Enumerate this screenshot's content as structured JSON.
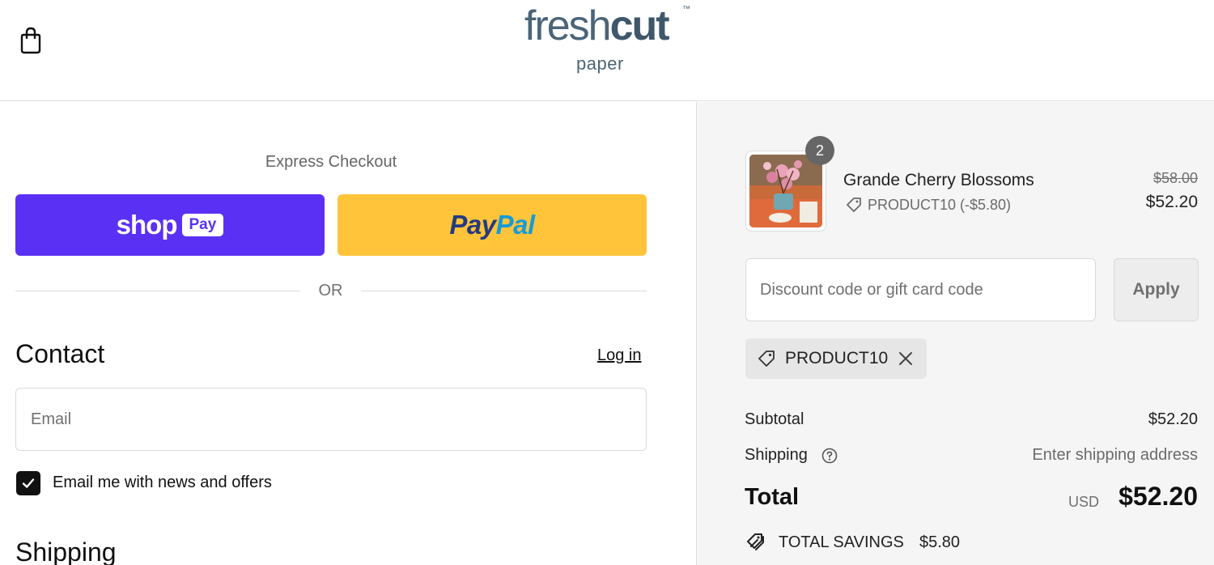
{
  "header": {
    "logo_main_light": "fresh",
    "logo_main_bold": "cut",
    "logo_tm": "™",
    "logo_sub": "paper",
    "cart_icon": "shopping-bag-icon"
  },
  "express": {
    "label": "Express Checkout",
    "shop_pay_word": "shop",
    "shop_pay_badge": "Pay",
    "paypal_pay": "Pay",
    "paypal_pal": "Pal",
    "or_label": "OR"
  },
  "contact": {
    "heading": "Contact",
    "login_link": "Log in",
    "email_placeholder": "Email",
    "email_value": "",
    "newsletter_label": "Email me with news and offers",
    "newsletter_checked": true
  },
  "shipping": {
    "heading": "Shipping"
  },
  "order": {
    "item": {
      "quantity": "2",
      "name": "Grande Cherry Blossoms",
      "discount_line": "PRODUCT10 (-$5.80)",
      "price_original": "$58.00",
      "price_final": "$52.20"
    },
    "discount_placeholder": "Discount code or gift card code",
    "apply_label": "Apply",
    "applied_code": "PRODUCT10",
    "subtotal_label": "Subtotal",
    "subtotal_value": "$52.20",
    "shipping_label": "Shipping",
    "shipping_value": "Enter shipping address",
    "total_label": "Total",
    "currency": "USD",
    "total_value": "$52.20",
    "savings_label": "TOTAL SAVINGS",
    "savings_value": "$5.80"
  },
  "colors": {
    "shop_pay": "#5a31f4",
    "paypal": "#ffc43a",
    "paypal_dark_blue": "#253b80",
    "paypal_light_blue": "#179bd7",
    "logo": "#4b6478",
    "summary_bg": "#f5f5f5"
  }
}
